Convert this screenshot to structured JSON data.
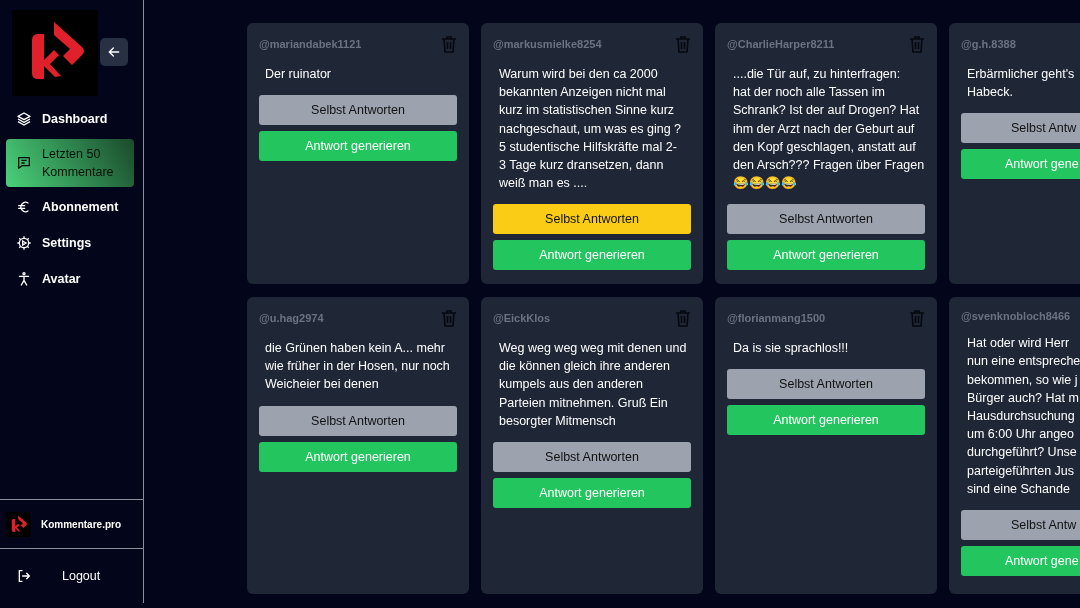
{
  "sidebar": {
    "nav": [
      {
        "label": "Dashboard",
        "selected": false
      },
      {
        "label": "Letzten 50 Kommentare",
        "selected": true
      },
      {
        "label": "Abonnement",
        "selected": false
      },
      {
        "label": "Settings",
        "selected": false
      },
      {
        "label": "Avatar",
        "selected": false
      }
    ],
    "brand": "Kommentare.pro",
    "logout": "Logout"
  },
  "columns": [
    [
      {
        "kind": "full",
        "user": "@mariandabek1121",
        "lines": [
          "Der ruinator"
        ],
        "own_reply": {
          "label": "Selbst Antworten",
          "highlighted": false
        },
        "generate": "Antwort generieren"
      },
      {
        "kind": "full",
        "user": "@u.hag2974",
        "lines": [
          "die Grünen haben kein A... mehr",
          "wie früher in der Hosen, nur noch",
          "Weicheier bei denen"
        ],
        "own_reply": {
          "label": "Selbst Antworten",
          "highlighted": false
        },
        "generate": "Antwort generieren"
      }
    ],
    [
      {
        "kind": "full",
        "user": "@markusmielke8254",
        "lines": [
          "Warum wird bei den ca 2000",
          "bekannten Anzeigen nicht mal",
          "kurz im statistischen Sinne kurz",
          "nachgeschaut, um was es ging ?",
          "5 studentische Hilfskräfte mal 2-",
          "3 Tage kurz dransetzen, dann",
          "weiß man es ...."
        ],
        "own_reply": {
          "label": "Selbst Antworten",
          "highlighted": true
        },
        "generate": "Antwort generieren"
      },
      {
        "kind": "full",
        "user": "@EickKlos",
        "lines": [
          "Weg weg weg weg mit denen und",
          "die können gleich ihre anderen",
          "kumpels aus den anderen",
          "Parteien mitnehmen. Gruß Ein",
          "besorgter Mitmensch"
        ],
        "own_reply": {
          "label": "Selbst Antworten",
          "highlighted": false
        },
        "generate": "Antwort generieren"
      }
    ],
    [
      {
        "kind": "full",
        "user": "@CharlieHarper8211",
        "lines": [
          "....die Tür auf, zu hinterfragen:",
          "hat der noch alle Tassen im",
          "Schrank? Ist der auf Drogen? Hat",
          "ihm der Arzt nach der Geburt auf",
          "den Kopf geschlagen, anstatt auf",
          "den Arsch??? Fragen über Fragen",
          "😂😂😂😂"
        ],
        "own_reply": {
          "label": "Selbst Antworten",
          "highlighted": false
        },
        "generate": "Antwort generieren"
      },
      {
        "kind": "full",
        "user": "@florianmang1500",
        "lines": [
          "Da is sie sprachlos!!!"
        ],
        "own_reply": {
          "label": "Selbst Antworten",
          "highlighted": false
        },
        "generate": "Antwort generieren"
      }
    ],
    [
      {
        "kind": "cut",
        "user": "@g.h.8388",
        "lines": [
          "Erbärmlicher geht's",
          "Habeck."
        ],
        "own_reply": {
          "label": "Selbst Antw",
          "highlighted": false
        },
        "generate": "Antwort gene"
      },
      {
        "kind": "cut",
        "user": "@svenknobloch8466",
        "lines": [
          "Hat oder wird Herr",
          "nun eine entspreche",
          "bekommen, so wie j",
          "Bürger auch? Hat m",
          "Hausdurchsuchung",
          "um 6:00 Uhr angeo",
          "durchgeführt? Unse",
          "parteigeführten Jus",
          "sind eine Schande"
        ],
        "own_reply": {
          "label": "Selbst Antw",
          "highlighted": false
        },
        "generate": "Antwort gene"
      }
    ]
  ]
}
